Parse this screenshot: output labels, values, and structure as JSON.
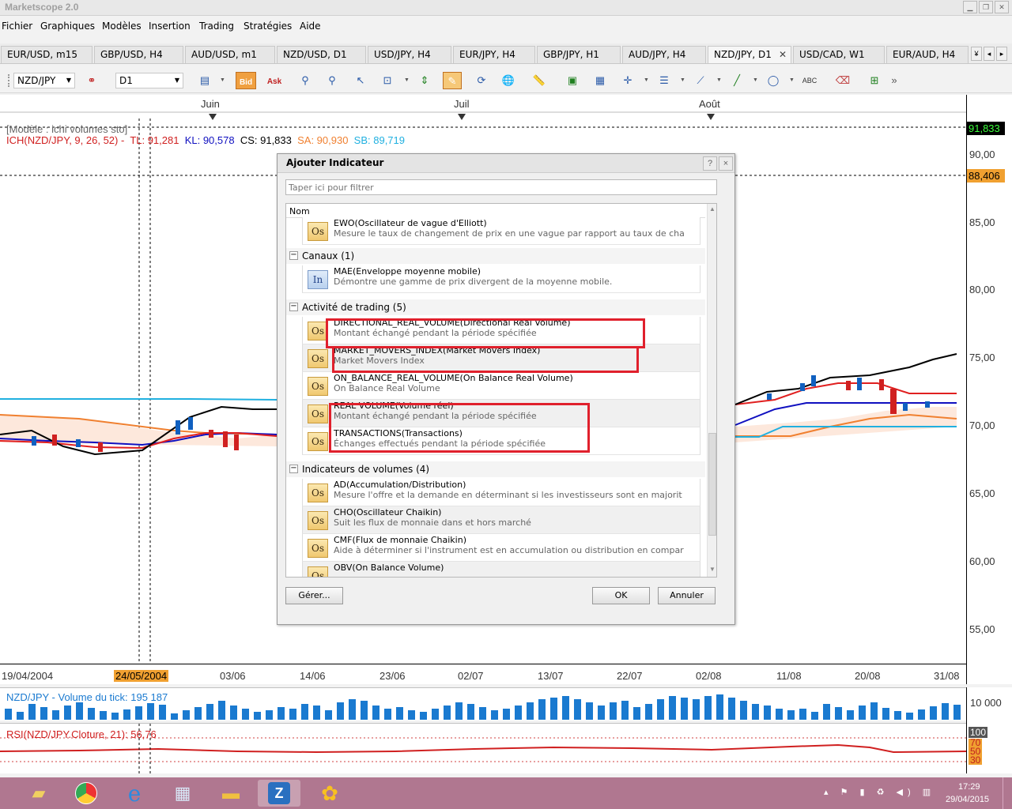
{
  "app": {
    "title": "Marketscope 2.0"
  },
  "menu": [
    "Fichier",
    "Graphiques",
    "Modèles",
    "Insertion",
    "Trading",
    "Stratégies",
    "Aide"
  ],
  "tabs": [
    {
      "label": "EUR/USD, m15"
    },
    {
      "label": "GBP/USD, H4"
    },
    {
      "label": "AUD/USD, m1"
    },
    {
      "label": "NZD/USD, D1"
    },
    {
      "label": "USD/JPY, H4"
    },
    {
      "label": "EUR/JPY, H4"
    },
    {
      "label": "GBP/JPY, H1"
    },
    {
      "label": "AUD/JPY, H4"
    },
    {
      "label": "NZD/JPY, D1",
      "active": true
    },
    {
      "label": "USD/CAD, W1"
    },
    {
      "label": "EUR/AUD, H4"
    }
  ],
  "toolbar": {
    "symbol": "NZD/JPY",
    "timeframe": "D1",
    "bid": "Bid",
    "ask": "Ask"
  },
  "chart": {
    "months": [
      "Juin",
      "Juil",
      "Août"
    ],
    "template": "[Modèle : ichi volumes sto]",
    "ich_label": "ICH(NZD/JPY, 9, 26, 52) -",
    "tl": "TL: 91,281",
    "kl": "KL: 90,578",
    "cs": "CS: 91,833",
    "sa": "SA: 90,930",
    "sb": "SB: 89,719",
    "price_ticks": [
      "90,00",
      "85,00",
      "80,00",
      "75,00",
      "70,00",
      "65,00",
      "60,00",
      "55,00"
    ],
    "price_current": "91,833",
    "price_marker": "88,406",
    "dates": [
      "19/04/2004",
      "24/05/2004",
      "03/06",
      "14/06",
      "23/06",
      "02/07",
      "13/07",
      "22/07",
      "02/08",
      "11/08",
      "20/08",
      "31/08"
    ],
    "highlighted_date": "24/05/2004",
    "colors": {
      "kijun": "#1010c0",
      "tenkan": "#e02020",
      "chikou": "#000000",
      "span_a": "#f08030",
      "span_b": "#20b0e0",
      "cloud": "#fde8dc"
    }
  },
  "volume": {
    "label": "NZD/JPY - Volume du tick: 195 187",
    "axis": "10 000"
  },
  "rsi": {
    "label": "RSI(NZD/JPY.Cloture, 21): 56,76",
    "levels": [
      "100",
      "70",
      "50",
      "30"
    ]
  },
  "dialog": {
    "title": "Ajouter Indicateur",
    "help": "?",
    "close": "×",
    "filter_placeholder": "Taper ici pour filtrer",
    "column": "Nom",
    "groups": [
      {
        "label": "Canaux (1)"
      },
      {
        "label": "Activité de trading (5)"
      },
      {
        "label": "Indicateurs de volumes (4)"
      }
    ],
    "items": [
      {
        "icon": "Os",
        "name": "EWO(Oscillateur de vague d'Elliott)",
        "desc": "Mesure le taux de changement de prix en une vague par rapport au taux de cha"
      },
      {
        "icon": "In",
        "name": "MAE(Enveloppe moyenne mobile)",
        "desc": "Démontre une gamme de prix divergent de la moyenne mobile."
      },
      {
        "icon": "Os",
        "name": "DIRECTIONAL_REAL_VOLUME(Directional Real Volume)",
        "desc": "Montant échangé pendant la période spécifiée"
      },
      {
        "icon": "Os",
        "name": "MARKET_MOVERS_INDEX(Market Movers Index)",
        "desc": "Market Movers Index"
      },
      {
        "icon": "Os",
        "name": "ON_BALANCE_REAL_VOLUME(On Balance Real Volume)",
        "desc": "On Balance Real Volume"
      },
      {
        "icon": "Os",
        "name": "REAL VOLUME(Volume réel)",
        "desc": "Montant échangé pendant la période spécifiée"
      },
      {
        "icon": "Os",
        "name": "TRANSACTIONS(Transactions)",
        "desc": "Échanges effectués pendant la période spécifiée"
      },
      {
        "icon": "Os",
        "name": "AD(Accumulation/Distribution)",
        "desc": "Mesure l'offre et la demande en déterminant si les investisseurs sont en majorit"
      },
      {
        "icon": "Os",
        "name": "CHO(Oscillateur Chaikin)",
        "desc": "Suit les flux de monnaie dans et hors marché"
      },
      {
        "icon": "Os",
        "name": "CMF(Flux de monnaie Chaikin)",
        "desc": "Aide à déterminer si l'instrument est en accumulation ou distribution en compar"
      },
      {
        "icon": "Os",
        "name": "OBV(On Balance Volume)",
        "desc": ""
      }
    ],
    "manage": "Gérer...",
    "ok": "OK",
    "cancel": "Annuler"
  },
  "taskbar": {
    "time": "17:29",
    "date": "29/04/2015"
  }
}
